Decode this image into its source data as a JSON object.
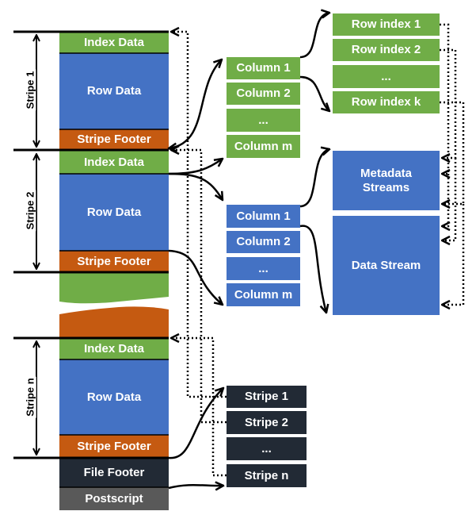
{
  "file_layout": {
    "stripes": [
      {
        "label": "Stripe 1",
        "index": "Index Data",
        "row": "Row Data",
        "footer": "Stripe Footer"
      },
      {
        "label": "Stripe 2",
        "index": "Index Data",
        "row": "Row Data",
        "footer": "Stripe Footer"
      },
      {
        "label": "Stripe n",
        "index": "Index Data",
        "row": "Row Data",
        "footer": "Stripe Footer"
      }
    ],
    "file_footer": "File Footer",
    "postscript": "Postscript"
  },
  "index_columns": [
    "Column 1",
    "Column 2",
    "...",
    "Column m"
  ],
  "row_indexes": [
    "Row index 1",
    "Row index 2",
    "...",
    "Row index k"
  ],
  "data_columns": [
    "Column 1",
    "Column 2",
    "...",
    "Column m"
  ],
  "streams": {
    "metadata": "Metadata Streams",
    "data": "Data Stream"
  },
  "footer_stripes": [
    "Stripe 1",
    "Stripe 2",
    "...",
    "Stripe n"
  ],
  "colors": {
    "index": "#70ad47",
    "row_data": "#4472c4",
    "stripe_footer": "#c55a11",
    "file_footer": "#222a35",
    "postscript": "#595959"
  }
}
